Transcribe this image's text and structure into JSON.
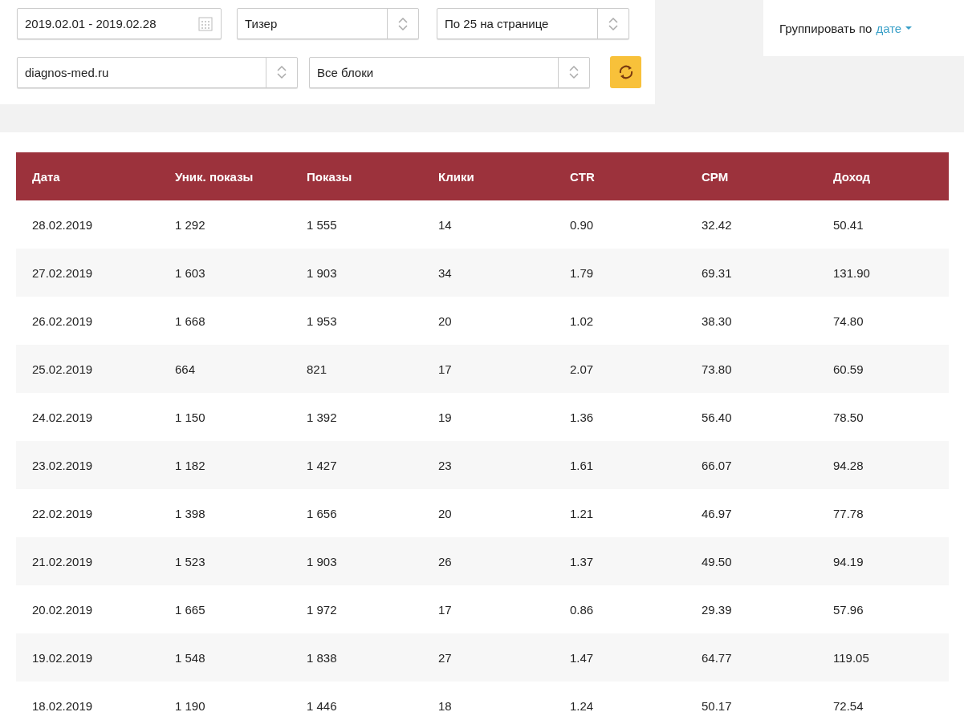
{
  "filters": {
    "date_range": "2019.02.01 - 2019.02.28",
    "type_select": "Тизер",
    "per_page_select": "По 25 на странице",
    "site_select": "diagnos-med.ru",
    "block_select": "Все блоки"
  },
  "grouping": {
    "label": "Группировать по",
    "value": "дате"
  },
  "table": {
    "columns": [
      "Дата",
      "Уник. показы",
      "Показы",
      "Клики",
      "CTR",
      "CPM",
      "Доход"
    ],
    "rows": [
      [
        "28.02.2019",
        "1 292",
        "1 555",
        "14",
        "0.90",
        "32.42",
        "50.41"
      ],
      [
        "27.02.2019",
        "1 603",
        "1 903",
        "34",
        "1.79",
        "69.31",
        "131.90"
      ],
      [
        "26.02.2019",
        "1 668",
        "1 953",
        "20",
        "1.02",
        "38.30",
        "74.80"
      ],
      [
        "25.02.2019",
        "664",
        "821",
        "17",
        "2.07",
        "73.80",
        "60.59"
      ],
      [
        "24.02.2019",
        "1 150",
        "1 392",
        "19",
        "1.36",
        "56.40",
        "78.50"
      ],
      [
        "23.02.2019",
        "1 182",
        "1 427",
        "23",
        "1.61",
        "66.07",
        "94.28"
      ],
      [
        "22.02.2019",
        "1 398",
        "1 656",
        "20",
        "1.21",
        "46.97",
        "77.78"
      ],
      [
        "21.02.2019",
        "1 523",
        "1 903",
        "26",
        "1.37",
        "49.50",
        "94.19"
      ],
      [
        "20.02.2019",
        "1 665",
        "1 972",
        "17",
        "0.86",
        "29.39",
        "57.96"
      ],
      [
        "19.02.2019",
        "1 548",
        "1 838",
        "27",
        "1.47",
        "64.77",
        "119.05"
      ],
      [
        "18.02.2019",
        "1 190",
        "1 446",
        "18",
        "1.24",
        "50.17",
        "72.54"
      ]
    ]
  }
}
